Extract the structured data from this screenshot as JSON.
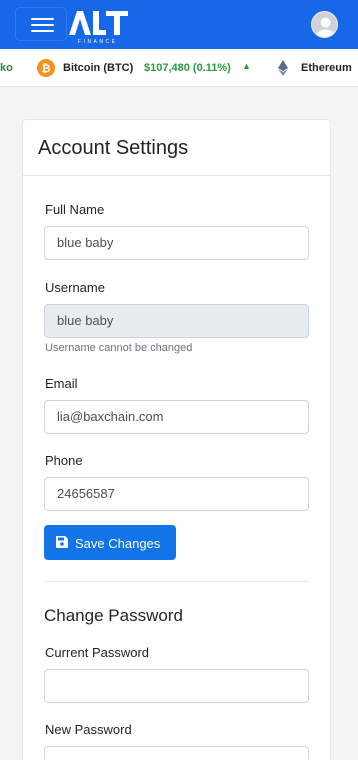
{
  "header": {
    "brand_logo_text": "ALT FINANCE",
    "menu_icon": "hamburger-icon",
    "avatar_icon": "user-avatar"
  },
  "ticker": {
    "leading_fragment": "ko",
    "items": [
      {
        "name": "Bitcoin (BTC)",
        "price": "$107,480 (0.11%)",
        "trend_icon": "triangle-up-icon",
        "coin_icon": "bitcoin-icon",
        "color": "#2a9b3e"
      },
      {
        "name": "Ethereum",
        "coin_icon": "ethereum-icon"
      }
    ]
  },
  "account": {
    "title": "Account Settings",
    "full_name": {
      "label": "Full Name",
      "value": "blue baby"
    },
    "username": {
      "label": "Username",
      "value": "blue baby",
      "hint": "Username cannot be changed"
    },
    "email": {
      "label": "Email",
      "value": "lia@baxchain.com"
    },
    "phone": {
      "label": "Phone",
      "value": "24656587"
    },
    "save_label": "Save Changes",
    "save_icon": "floppy-disk-icon"
  },
  "password": {
    "title": "Change Password",
    "current_label": "Current Password",
    "current_value": "",
    "new_label": "New Password",
    "new_value": ""
  },
  "colors": {
    "primary": "#1768e8",
    "button": "#1374e8",
    "positive": "#2a9b3e",
    "bitcoin": "#f7931a"
  }
}
